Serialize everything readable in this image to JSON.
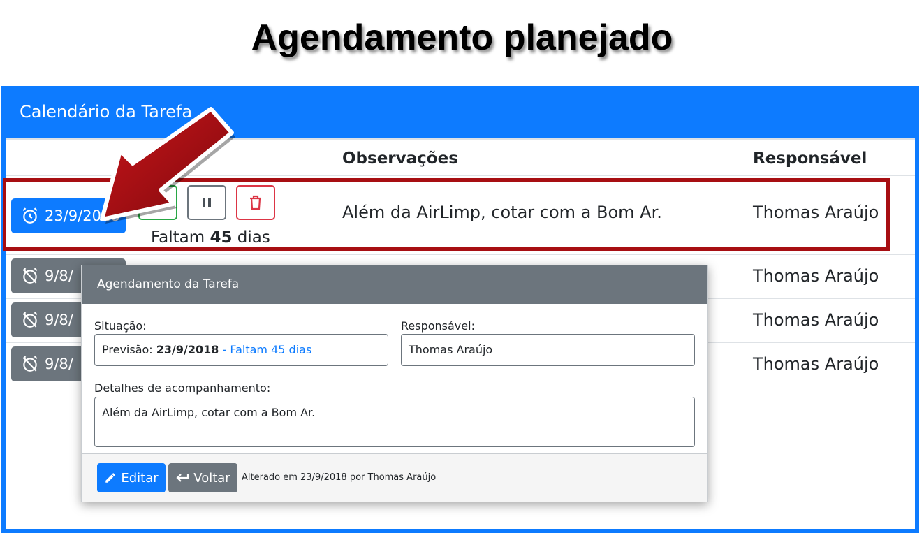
{
  "slide_title": "Agendamento planejado",
  "card": {
    "title": "Calendário da Tarefa",
    "columns": {
      "observacoes": "Observações",
      "responsavel": "Responsável"
    }
  },
  "rows": [
    {
      "date": "23/9/2018",
      "remaining_prefix": "Faltam",
      "remaining_days": "45",
      "remaining_suffix": "dias",
      "observation": "Além da AirLimp, cotar com a Bom Ar.",
      "responsible": "Thomas Araújo"
    },
    {
      "date": "9/8/",
      "responsible": "Thomas Araújo"
    },
    {
      "date": "9/8/",
      "responsible": "Thomas Araújo"
    },
    {
      "date": "9/8/",
      "responsible": "Thomas Araújo"
    }
  ],
  "modal": {
    "title": "Agendamento da Tarefa",
    "situacao_label": "Situação:",
    "situacao": {
      "prefix": "Previsão:",
      "date": "23/9/2018",
      "separator": "-",
      "remaining": "Faltam 45 dias"
    },
    "responsavel_label": "Responsável:",
    "responsavel_value": "Thomas Araújo",
    "detalhes_label": "Detalhes de acompanhamento:",
    "detalhes_value": "Além da AirLimp, cotar com a Bom Ar.",
    "edit_label": "Editar",
    "back_label": "Voltar",
    "footer_note": "Alterado em 23/9/2018 por Thomas Araújo"
  },
  "colors": {
    "primary": "#0d7bff",
    "secondary": "#6c757d",
    "success": "#28a745",
    "danger": "#dc3545",
    "highlight": "#a70e12"
  }
}
